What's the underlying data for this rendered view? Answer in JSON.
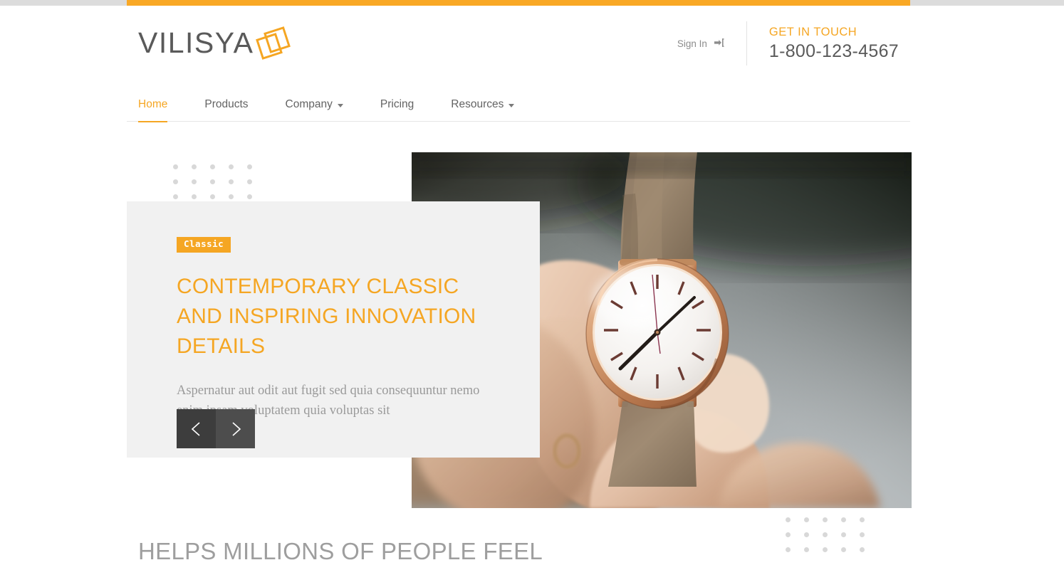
{
  "topbar": {
    "progress_color": "#F9A825",
    "track_color": "#dcdcdc"
  },
  "header": {
    "logo_text": "VILISYA",
    "logo_icon": "rotated-squares-icon",
    "signin_label": "Sign In",
    "signin_icon": "sign-in-arrow-icon",
    "contact_label": "GET IN TOUCH",
    "contact_phone": "1-800-123-4567"
  },
  "nav": {
    "items": [
      {
        "label": "Home",
        "active": true,
        "caret": false
      },
      {
        "label": "Products",
        "active": false,
        "caret": false
      },
      {
        "label": "Company",
        "active": false,
        "caret": true
      },
      {
        "label": "Pricing",
        "active": false,
        "caret": false
      },
      {
        "label": "Resources",
        "active": false,
        "caret": true
      }
    ]
  },
  "hero": {
    "badge": "Classic",
    "title": "CONTEMPORARY CLASSIC AND INSPIRING INNOVATION DETAILS",
    "description": "Aspernatur aut odit aut fugit sed quia consequuntur nemo enim ipsam voluptatem quia voluptas sit",
    "prev_icon": "chevron-left-icon",
    "next_icon": "chevron-right-icon",
    "image_alt": "hand-holding-rose-gold-watch",
    "decor_icon": "dot-grid-icon"
  },
  "section": {
    "heading": "HELPS MILLIONS OF PEOPLE FEEL"
  },
  "colors": {
    "accent": "#F5A623",
    "text_dark": "#5a5a5a",
    "text_muted": "#9a9a9a",
    "panel_bg": "#f1f1f1"
  }
}
